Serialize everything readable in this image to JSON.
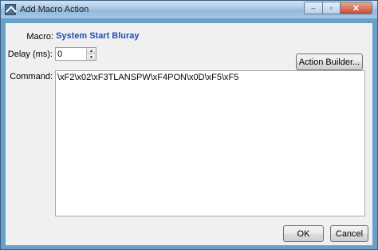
{
  "window": {
    "title": "Add Macro Action",
    "minimize": "–",
    "maximize": "▫",
    "close": "✕"
  },
  "form": {
    "macro_label": "Macro:",
    "macro_value": "System Start Bluray",
    "delay_label": "Delay (ms):",
    "delay_value": "0",
    "command_label": "Command:",
    "command_value": "\\xF2\\x02\\xF3TLANSPW\\xF4PON\\x0D\\xF5\\xF5"
  },
  "buttons": {
    "action_builder": "Action Builder...",
    "ok": "OK",
    "cancel": "Cancel"
  },
  "spin": {
    "up": "▲",
    "down": "▼"
  }
}
